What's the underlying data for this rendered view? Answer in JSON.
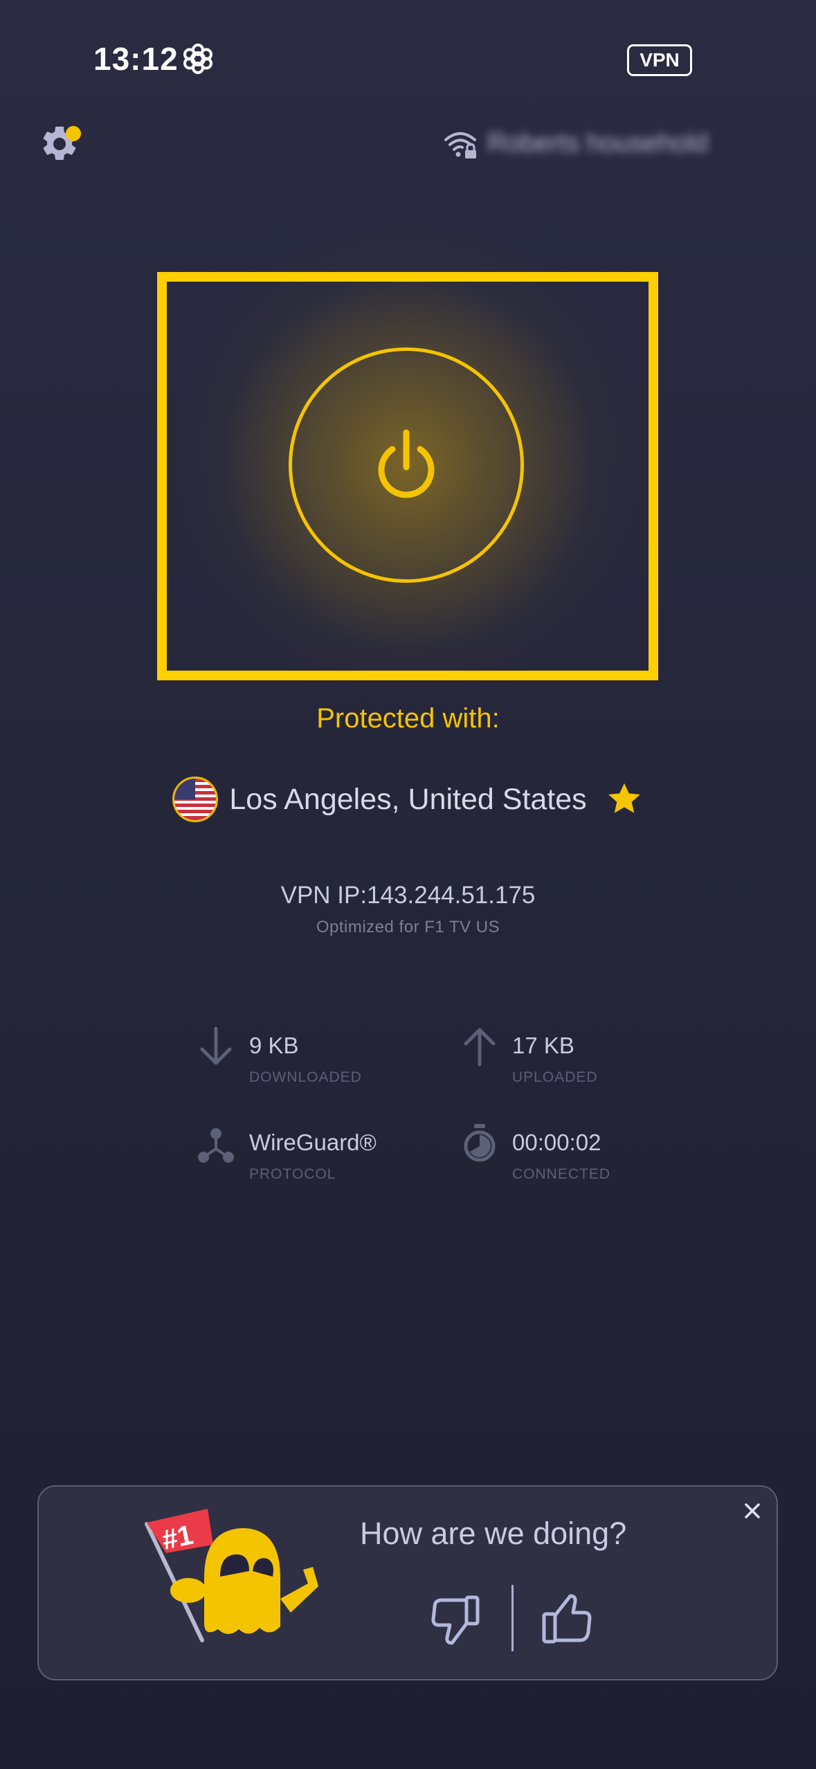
{
  "status_bar": {
    "time": "13:12",
    "vpn_badge": "VPN"
  },
  "header": {
    "network_name": "Roberts household"
  },
  "connection": {
    "status_label": "Protected with:",
    "location": "Los Angeles, United States",
    "vpn_ip": "VPN IP:143.244.51.175",
    "optimized_for": "Optimized for F1 TV US"
  },
  "stats": {
    "downloaded": {
      "value": "9 KB",
      "label": "DOWNLOADED"
    },
    "uploaded": {
      "value": "17 KB",
      "label": "UPLOADED"
    },
    "protocol": {
      "value": "WireGuard®",
      "label": "PROTOCOL"
    },
    "connected": {
      "value": "00:00:02",
      "label": "CONNECTED"
    }
  },
  "feedback": {
    "question": "How are we doing?",
    "badge": "#1"
  },
  "colors": {
    "accent": "#f5c400",
    "background": "#242538",
    "card": "#2f3044"
  },
  "icons": [
    "settings-gear-icon",
    "wifi-lock-icon",
    "power-icon",
    "us-flag-icon",
    "star-icon",
    "download-arrow-icon",
    "upload-arrow-icon",
    "protocol-icon",
    "timer-icon",
    "close-icon",
    "thumbs-down-icon",
    "thumbs-up-icon"
  ]
}
